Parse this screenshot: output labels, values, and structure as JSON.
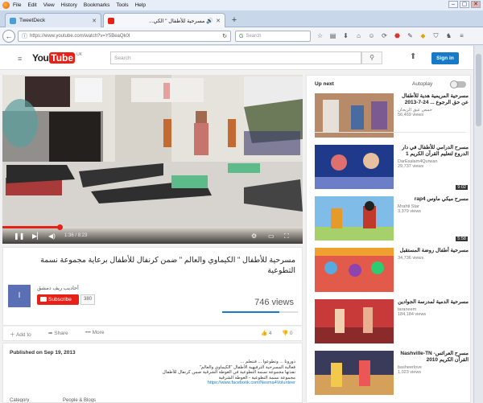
{
  "browser": {
    "menus": [
      "File",
      "Edit",
      "View",
      "History",
      "Bookmarks",
      "Tools",
      "Help"
    ],
    "tabs": [
      {
        "title": "TweetDeck",
        "active": false
      },
      {
        "title": "مسرحية للأطفال \" الكي...",
        "active": true
      }
    ],
    "url": "https://www.youtube.com/watch?v=Y5BeaQk0I",
    "search_placeholder": "Search",
    "new_tab": "+",
    "window_controls": [
      "–",
      "▢",
      "✕"
    ]
  },
  "youtube": {
    "logo_you": "You",
    "logo_tube": "Tube",
    "logo_region": "UK",
    "search_placeholder": "Search",
    "sign_in": "Sign in"
  },
  "player": {
    "time": "1:36 / 8:23",
    "progress": 0.19,
    "palette": {
      "red": "#e62117",
      "blue": "#167ac6"
    }
  },
  "video": {
    "title": "مسرحية للأطفال \" الكيماوي والعالم \" ضمن كرنفال للأطفال برعاية مجموعة نسمة التطوعية",
    "channel": "أحاديب ريف دمشق",
    "avatar_letter": "I",
    "subscribe_label": "Subscribe",
    "subscriber_count": "380",
    "views": "746 views",
    "like_ratio": 0.75,
    "add_to": "Add to",
    "share": "Share",
    "more": "More",
    "likes": "4",
    "dislikes": "0"
  },
  "description": {
    "published": "Published on Sep 19, 2013",
    "lines": [
      "ذورونا ... وتطوعوا ... فنتعلم ...",
      "فعالية المسرحية الترفيهية الأطفال \"الكيماوي والعالم\"",
      "نفذتها مجموعة نسمة التطوعية في الغوطة الشرقية ضمن كرنفال للأطفال",
      "مجموعة نسمة التطوعية - الغوطة الشرقية"
    ],
    "link": "https://www.facebook.com/Nesma4Volunteer",
    "category_label": "Category",
    "category": "People & Blogs"
  },
  "sidebar": {
    "up_next": "Up next",
    "autoplay": "Autoplay",
    "items": [
      {
        "title": "مسرحية المريمية هدية للأطفال عن حق الرجوع ... 24-7-2013",
        "channel": "حمص عبق الريحان",
        "views": "56,469 views",
        "duration": ""
      },
      {
        "title": "مسرح الدرامي للأطفال في دار الدروع لتعليم القرآن الكريم 1",
        "channel": "DarEsalam4Qurwan",
        "views": "29,737 views",
        "duration": "9:02"
      },
      {
        "title": "مسرح ميكي ماوس rap4",
        "channel": "Mrahti Star",
        "views": "3,379 views",
        "duration": "5:58"
      },
      {
        "title": "مسرحية أطفال روضة المستقبل",
        "channel": "",
        "views": "34,736 views",
        "duration": ""
      },
      {
        "title": "مسرحية الدمية لمدرسة الجوادين",
        "channel": "taraneem",
        "views": "184,184 views",
        "duration": ""
      },
      {
        "title": "مسرح العرائس- Nashville-TN القرآن الكريم 2010",
        "channel": "basheerlove",
        "views": "1,023 views",
        "duration": ""
      }
    ]
  }
}
